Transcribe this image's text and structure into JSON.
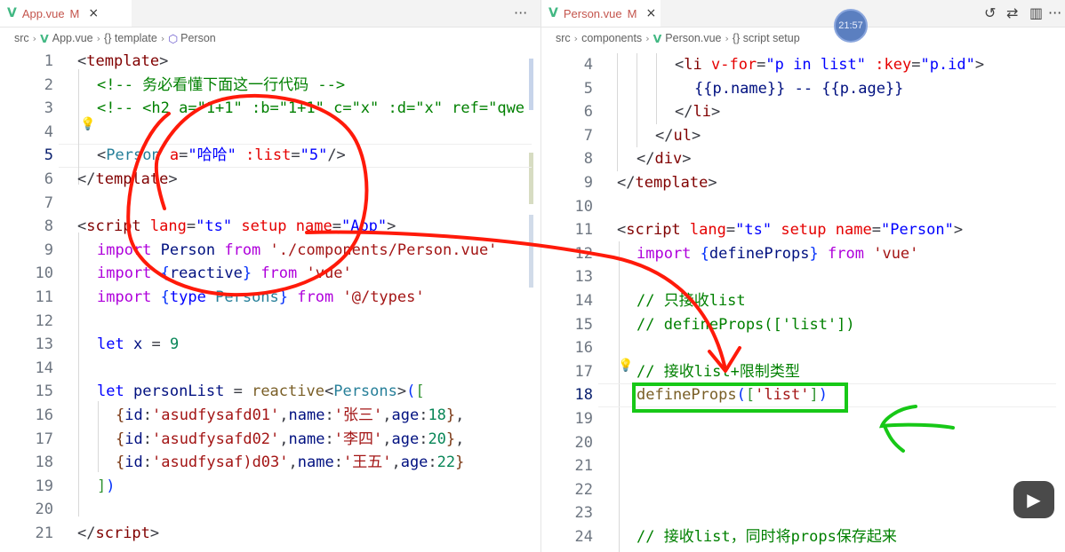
{
  "left": {
    "tab": {
      "label": "App.vue",
      "mod": "M",
      "close": "×"
    },
    "more": "···",
    "crumbs": {
      "a": "src",
      "b": "App.vue",
      "c": "{} template",
      "d": "Person"
    },
    "lines": [
      {
        "n": "1"
      },
      {
        "n": "2"
      },
      {
        "n": "3"
      },
      {
        "n": "4"
      },
      {
        "n": "5"
      },
      {
        "n": "6"
      },
      {
        "n": "7"
      },
      {
        "n": "8"
      },
      {
        "n": "9"
      },
      {
        "n": "10"
      },
      {
        "n": "11"
      },
      {
        "n": "12"
      },
      {
        "n": "13"
      },
      {
        "n": "14"
      },
      {
        "n": "15"
      },
      {
        "n": "16"
      },
      {
        "n": "17"
      },
      {
        "n": "18"
      },
      {
        "n": "19"
      },
      {
        "n": "20"
      },
      {
        "n": "21"
      }
    ],
    "code": {
      "l1": "template",
      "l2": "<!-- 务必看懂下面这一行代码 -->",
      "l3": "<!-- <h2 a=\"1+1\" :b=\"1+1\" c=\"x\" :d=\"x\" ref=\"qwe",
      "l5_tag": "Person",
      "l5_attr1": "a",
      "l5_val1": "\"哈哈\"",
      "l5_attr2": ":list",
      "l5_val2": "\"5\"",
      "l6": "template",
      "l8_tag": "script",
      "l8_a1": "lang",
      "l8_v1": "\"ts\"",
      "l8_a2": "setup",
      "l8_a3": "name",
      "l8_v3": "\"App\"",
      "l9_a": "import",
      "l9_b": "Person",
      "l9_c": "from",
      "l9_d": "'./components/Person.vue'",
      "l10_a": "import",
      "l10_b": "reactive",
      "l10_c": "from",
      "l10_d": "'vue'",
      "l11_a": "import",
      "l11_b": "type",
      "l11_c": "Persons",
      "l11_d": "from",
      "l11_e": "'@/types'",
      "l13_a": "let",
      "l13_b": "x",
      "l13_c": "9",
      "l15_a": "let",
      "l15_b": "personList",
      "l15_c": "reactive",
      "l15_d": "Persons",
      "l16": {
        "id": "'asudfysafd01'",
        "name": "'张三'",
        "age": "18"
      },
      "l17": {
        "id": "'asudfysafd02'",
        "name": "'李四'",
        "age": "20"
      },
      "l18": {
        "id": "'asudfysaf)d03'",
        "name": "'王五'",
        "age": "22"
      },
      "l21": "script"
    }
  },
  "right": {
    "tab": {
      "label": "Person.vue",
      "mod": "M",
      "close": "×"
    },
    "toolbar": {
      "history": "↺",
      "compare": "⇄",
      "split": "▥",
      "more": "···"
    },
    "timer": "21:57",
    "crumbs": {
      "a": "src",
      "b": "components",
      "c": "Person.vue",
      "d": "{} script setup"
    },
    "lines": [
      {
        "n": "4"
      },
      {
        "n": "5"
      },
      {
        "n": "6"
      },
      {
        "n": "7"
      },
      {
        "n": "8"
      },
      {
        "n": "9"
      },
      {
        "n": "10"
      },
      {
        "n": "11"
      },
      {
        "n": "12"
      },
      {
        "n": "13"
      },
      {
        "n": "14"
      },
      {
        "n": "15"
      },
      {
        "n": "16"
      },
      {
        "n": "17"
      },
      {
        "n": "18"
      },
      {
        "n": "19"
      },
      {
        "n": "20"
      },
      {
        "n": "21"
      },
      {
        "n": "22"
      },
      {
        "n": "23"
      },
      {
        "n": "24"
      }
    ],
    "code": {
      "l4_tag": "li",
      "l4_a1": "v-for",
      "l4_v1": "\"p in list\"",
      "l4_a2": ":key",
      "l4_v2": "\"p.id\"",
      "l5": "{{p.name}} -- {{p.age}}",
      "l6": "li",
      "l7": "ul",
      "l8": "div",
      "l9": "template",
      "l11_tag": "script",
      "l11_a1": "lang",
      "l11_v1": "\"ts\"",
      "l11_a2": "setup",
      "l11_a3": "name",
      "l11_v3": "\"Person\"",
      "l12_a": "import",
      "l12_b": "defineProps",
      "l12_c": "from",
      "l12_d": "'vue'",
      "l14": "// 只接收list",
      "l15": "// defineProps(['list'])",
      "l17": "// 接收list+限制类型",
      "l18_fn": "defineProps",
      "l18_str": "'list'",
      "l24": "// 接收list，同时将props保存起来"
    }
  },
  "colors": {
    "annotation_red": "#ff1a0a",
    "annotation_green": "#17c817",
    "vue_green": "#42b883"
  }
}
